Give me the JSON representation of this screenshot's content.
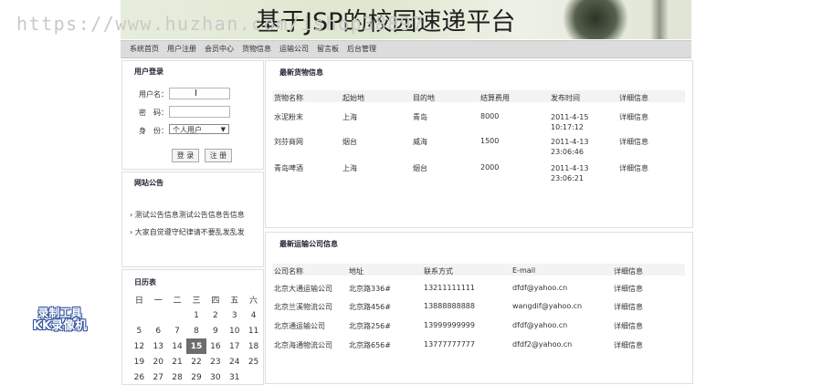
{
  "header": {
    "title": "基于JSP的校园速递平台",
    "watermark": "https://www.huzhan.com/ishop38897"
  },
  "nav": [
    "系统首页",
    "用户注册",
    "会员中心",
    "货物信息",
    "运输公司",
    "留言板",
    "后台管理"
  ],
  "login": {
    "title": "用户登录",
    "username_label": "用户名：",
    "password_label": "密　码：",
    "role_label": "身　份：",
    "role_value": "个人用户",
    "login_btn": "登 录",
    "register_btn": "注 册"
  },
  "notices": {
    "title": "网站公告",
    "items": [
      "测试公告信息测试公告信息告信息",
      "大家自觉遵守纪律请不要乱发乱发"
    ]
  },
  "calendar": {
    "title": "日历表",
    "weekdays": [
      "日",
      "一",
      "二",
      "三",
      "四",
      "五",
      "六"
    ],
    "rows": [
      [
        "",
        "",
        "",
        "1",
        "2",
        "3",
        "4"
      ],
      [
        "5",
        "6",
        "7",
        "8",
        "9",
        "10",
        "11"
      ],
      [
        "12",
        "13",
        "14",
        "15",
        "16",
        "17",
        "18"
      ],
      [
        "19",
        "20",
        "21",
        "22",
        "23",
        "24",
        "25"
      ],
      [
        "26",
        "27",
        "28",
        "29",
        "30",
        "31",
        ""
      ]
    ],
    "today": "15"
  },
  "goods": {
    "title": "最新货物信息",
    "headers": [
      "货物名称",
      "起始地",
      "目的地",
      "结算费用",
      "发布时间",
      "详细信息"
    ],
    "rows": [
      [
        "水泥粉末",
        "上海",
        "青岛",
        "8000",
        "2011-4-15 10:17:12",
        "详细信息"
      ],
      [
        "刘芬商网",
        "烟台",
        "威海",
        "1500",
        "2011-4-13 23:06:46",
        "详细信息"
      ],
      [
        "青岛啤酒",
        "上海",
        "烟台",
        "2000",
        "2011-4-13 23:06:21",
        "详细信息"
      ]
    ]
  },
  "companies": {
    "title": "最新运输公司信息",
    "headers": [
      "公司名称",
      "地址",
      "联系方式",
      "E-mail",
      "详细信息"
    ],
    "rows": [
      [
        "北京大通运输公司",
        "北京路336#",
        "13211111111",
        "dfdf@yahoo.cn",
        "详细信息"
      ],
      [
        "北京兰溪物流公司",
        "北京路456#",
        "13888888888",
        "wangdif@yahoo.cn",
        "详细信息"
      ],
      [
        "北京通运输公司",
        "北京路256#",
        "13999999999",
        "dfdf@yahoo.cn",
        "详细信息"
      ],
      [
        "北京海通物流公司",
        "北京路656#",
        "13777777777",
        "dfdf2@yahoo.cn",
        "详细信息"
      ]
    ]
  },
  "overlay": {
    "line1": "录制工具",
    "line2": "KK录像机"
  },
  "colors": {
    "nav_bg": "#dcdcdc",
    "today_bg": "#6d6d6d",
    "banner_bg": "#dfe7cf"
  }
}
